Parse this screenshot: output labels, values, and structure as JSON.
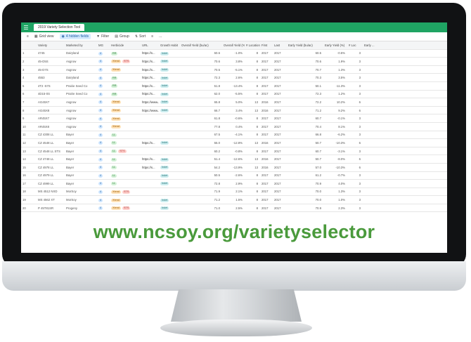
{
  "app": {
    "tab_title": "2019 Variety Selection Tool"
  },
  "toolbar": {
    "view_label": "Grid view",
    "hidden_fields": "4 hidden fields",
    "filter": "Filter",
    "group": "Group",
    "sort": "Sort",
    "more": "..."
  },
  "columns": [
    "",
    "",
    "Variety",
    "Marketed by",
    "MG",
    "Herbicide",
    "URL",
    "Growth Habit",
    "Overall Yield (bu/ac)",
    "Overall Yield (%)",
    "# Locations",
    "First",
    "Last",
    "Early Yield (bu/ac)",
    "Early Yield (%)",
    "# Loc",
    "Early ..."
  ],
  "rows": [
    {
      "n": "1",
      "v": "4745",
      "m": "Dairyland",
      "mg": "4",
      "h": "RR",
      "hx": "",
      "u": "https://s...",
      "g": "Indet",
      "oy": "60.6",
      "op": "-1.0%",
      "nl": "8",
      "f": "2017",
      "l": "2017",
      "ey": "60.5",
      "ep": "-0.5%",
      "el": "3"
    },
    {
      "n": "2",
      "v": "45-D5S",
      "m": "Asgrow",
      "mg": "4",
      "h": "Xtend",
      "hx": "STS",
      "u": "https://s...",
      "g": "Indet",
      "oy": "70.6",
      "op": "3.8%",
      "nl": "8",
      "f": "2017",
      "l": "2017",
      "ey": "70.6",
      "ep": "1.9%",
      "el": "3"
    },
    {
      "n": "3",
      "v": "45-D7S",
      "m": "Asgrow",
      "mg": "4",
      "h": "Xtend",
      "hx": "",
      "u": "https://s...",
      "g": "Indet",
      "oy": "70.5",
      "op": "-5.1%",
      "nl": "8",
      "f": "2017",
      "l": "2017",
      "ey": "70.7",
      "ep": "1.3%",
      "el": "3"
    },
    {
      "n": "4",
      "v": "4553",
      "m": "Dairyland",
      "mg": "4",
      "h": "RR",
      "hx": "",
      "u": "https://s...",
      "g": "Indet",
      "oy": "72.3",
      "op": "2.6%",
      "nl": "8",
      "f": "2017",
      "l": "2017",
      "ey": "70.3",
      "ep": "3.5%",
      "el": "3"
    },
    {
      "n": "5",
      "v": "4T2 -57S",
      "m": "Prairie Seed Co",
      "mg": "4",
      "h": "RR",
      "hx": "",
      "u": "https://s...",
      "g": "Indet",
      "oy": "51.8",
      "op": "-13.4%",
      "nl": "8",
      "f": "2017",
      "l": "2017",
      "ey": "50.1",
      "ep": "-11.3%",
      "el": "3"
    },
    {
      "n": "6",
      "v": "4D15-0S",
      "m": "Prairie Seed Co",
      "mg": "4",
      "h": "RR",
      "hx": "",
      "u": "https://s...",
      "g": "Indet",
      "oy": "62.0",
      "op": "-5.5%",
      "nl": "8",
      "f": "2017",
      "l": "2017",
      "ey": "72.3",
      "ep": "1.2%",
      "el": "3"
    },
    {
      "n": "7",
      "v": "AG45X7",
      "m": "Asgrow",
      "mg": "4",
      "h": "Xtend",
      "hx": "",
      "u": "https://www...",
      "g": "Indet",
      "oy": "65.8",
      "op": "5.0%",
      "nl": "13",
      "f": "2016",
      "l": "2017",
      "ey": "72.2",
      "ep": "10.2%",
      "el": "6"
    },
    {
      "n": "8",
      "v": "AG45X8",
      "m": "Asgrow",
      "mg": "4",
      "h": "Xtend",
      "hx": "",
      "u": "https://www...",
      "g": "Indet",
      "oy": "66.7",
      "op": "3.4%",
      "nl": "13",
      "f": "2016",
      "l": "2017",
      "ey": "71.2",
      "ep": "9.2%",
      "el": "6"
    },
    {
      "n": "9",
      "v": "AR45X7",
      "m": "Asgrow",
      "mg": "4",
      "h": "Xtend",
      "hx": "",
      "u": "",
      "g": "",
      "oy": "61.8",
      "op": "-0.6%",
      "nl": "8",
      "f": "2017",
      "l": "2017",
      "ey": "60.7",
      "ep": "-0.1%",
      "el": "3"
    },
    {
      "n": "10",
      "v": "AR45X8",
      "m": "Asgrow",
      "mg": "4",
      "h": "Xtend",
      "hx": "",
      "u": "",
      "g": "",
      "oy": "77.8",
      "op": "0.4%",
      "nl": "8",
      "f": "2017",
      "l": "2017",
      "ey": "70.4",
      "ep": "8.1%",
      "el": "3"
    },
    {
      "n": "11",
      "v": "CZ 4308 LL",
      "m": "Bayer",
      "mg": "4",
      "h": "LL",
      "hx": "",
      "u": "",
      "g": "",
      "oy": "67.5",
      "op": "-4.1%",
      "nl": "8",
      "f": "2017",
      "l": "2017",
      "ey": "66.8",
      "ep": "-6.2%",
      "el": "3"
    },
    {
      "n": "12",
      "v": "CZ 4548 LL",
      "m": "Bayer",
      "mg": "4",
      "h": "LL",
      "hx": "",
      "u": "https://s...",
      "g": "Indet",
      "oy": "55.0",
      "op": "-12.8%",
      "nl": "13",
      "f": "2016",
      "l": "2017",
      "ey": "50.7",
      "ep": "-10.3%",
      "el": "6"
    },
    {
      "n": "13",
      "v": "CZ 4548 LL STS",
      "m": "Bayer",
      "mg": "4",
      "h": "LL",
      "hx": "STS",
      "u": "",
      "g": "",
      "oy": "60.2",
      "op": "-0.8%",
      "nl": "8",
      "f": "2017",
      "l": "2017",
      "ey": "60.7",
      "ep": "-3.1%",
      "el": "3"
    },
    {
      "n": "14",
      "v": "CZ 4748 LL",
      "m": "Bayer",
      "mg": "4",
      "h": "LL",
      "hx": "",
      "u": "https://s...",
      "g": "Indet",
      "oy": "51.4",
      "op": "-12.6%",
      "nl": "13",
      "f": "2016",
      "l": "2017",
      "ey": "50.7",
      "ep": "-8.0%",
      "el": "6"
    },
    {
      "n": "15",
      "v": "CZ 4978 LL",
      "m": "Bayer",
      "mg": "4",
      "h": "LL",
      "hx": "",
      "u": "https://s...",
      "g": "Indet",
      "oy": "54.2",
      "op": "-13.9%",
      "nl": "13",
      "f": "2016",
      "l": "2017",
      "ey": "57.0",
      "ep": "-10.3%",
      "el": "6"
    },
    {
      "n": "16",
      "v": "CZ 4979 LL",
      "m": "Bayer",
      "mg": "4",
      "h": "LL",
      "hx": "",
      "u": "",
      "g": "Indet",
      "oy": "50.5",
      "op": "-2.6%",
      "nl": "8",
      "f": "2017",
      "l": "2017",
      "ey": "61.2",
      "ep": "-0.7%",
      "el": "3"
    },
    {
      "n": "17",
      "v": "CZ 4999 LL",
      "m": "Bayer",
      "mg": "4",
      "h": "LL",
      "hx": "",
      "u": "",
      "g": "Indet",
      "oy": "72.8",
      "op": "2.9%",
      "nl": "8",
      "f": "2017",
      "l": "2017",
      "ey": "70.9",
      "ep": "4.0%",
      "el": "3"
    },
    {
      "n": "18",
      "v": "MS 4512 NXD",
      "m": "MorSoy",
      "mg": "4",
      "h": "Xtend",
      "hx": "STS",
      "u": "",
      "g": "",
      "oy": "71.9",
      "op": "2.1%",
      "nl": "8",
      "f": "2017",
      "l": "2017",
      "ey": "70.0",
      "ep": "1.3%",
      "el": "3"
    },
    {
      "n": "19",
      "v": "MS 4562 XT",
      "m": "MorSoy",
      "mg": "4",
      "h": "Xtend",
      "hx": "",
      "u": "",
      "g": "Indet",
      "oy": "71.2",
      "op": "1.5%",
      "nl": "8",
      "f": "2017",
      "l": "2017",
      "ey": "70.0",
      "ep": "1.0%",
      "el": "3"
    },
    {
      "n": "20",
      "v": "P 45T81SR",
      "m": "Progeny",
      "mg": "4",
      "h": "Xtend",
      "hx": "STS",
      "u": "",
      "g": "Indet",
      "oy": "71.0",
      "op": "2.5%",
      "nl": "8",
      "f": "2017",
      "l": "2017",
      "ey": "70.9",
      "ep": "2.3%",
      "el": "3"
    }
  ],
  "banner": {
    "url_text": "www.ncsoy.org/varietyselector"
  }
}
